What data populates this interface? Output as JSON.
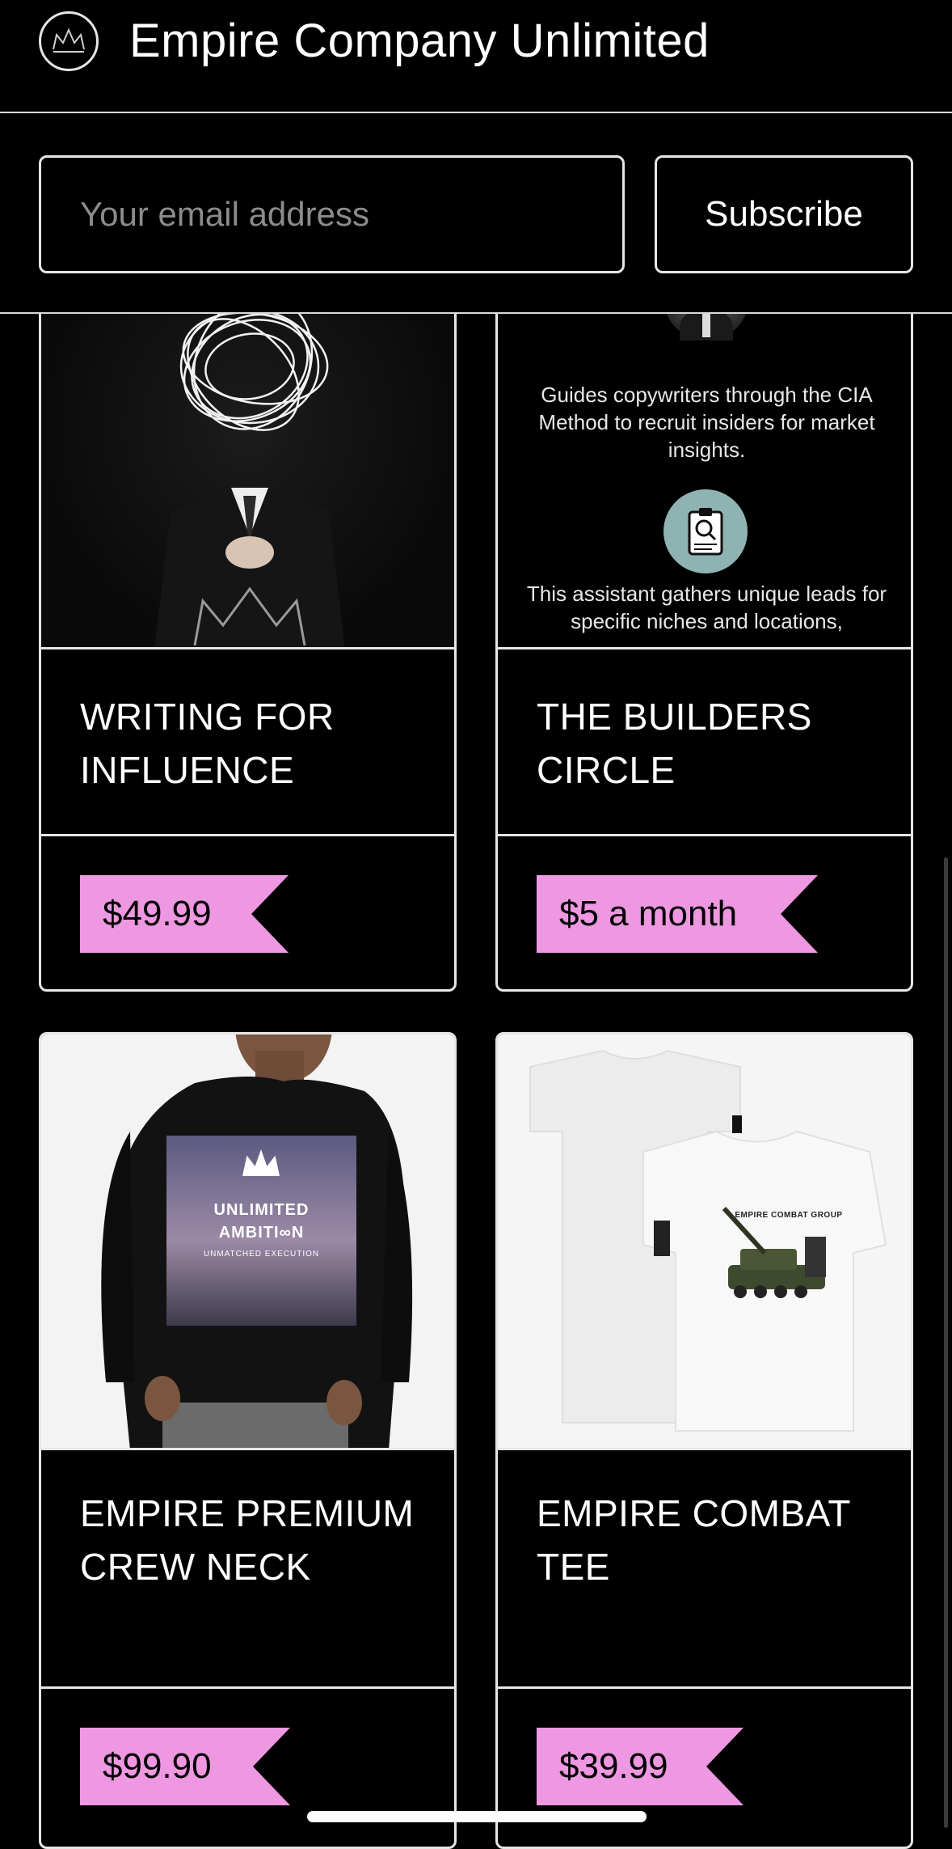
{
  "header": {
    "title": "Empire Company Unlimited",
    "logo_icon": "crown-icon"
  },
  "subscribe": {
    "email_placeholder": "Your email address",
    "email_value": "",
    "button_label": "Subscribe"
  },
  "products": [
    {
      "title": "WRITING FOR INFLUENCE",
      "price": "$49.99",
      "image": "scribble-head-man-photo"
    },
    {
      "title": "THE BUILDERS CIRCLE",
      "price": "$5 a month",
      "image": "assistant-list-preview",
      "preview_items": [
        "Guides copywriters through the CIA Method to recruit insiders for market insights.",
        "This assistant gathers unique leads for specific niches and locations,"
      ]
    },
    {
      "title": "EMPIRE PREMIUM CREW NECK",
      "price": "$99.90",
      "image": "black-sweatshirt-photo",
      "print_lines": [
        "UNLIMITED",
        "AMBITI∞N",
        "UNMATCHED EXECUTION"
      ]
    },
    {
      "title": "EMPIRE COMBAT TEE",
      "price": "$39.99",
      "image": "white-tshirt-photo",
      "print_lines": [
        "EMPIRE COMBAT GROUP"
      ]
    }
  ],
  "colors": {
    "background": "#000000",
    "border": "#e6e6e6",
    "price_tag": "#ee98e2"
  }
}
